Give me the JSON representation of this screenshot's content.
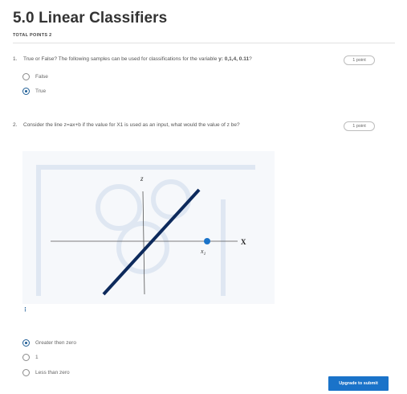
{
  "quiz": {
    "title": "5.0 Linear Classifiers",
    "total_points": "TOTAL POINTS 2"
  },
  "questions": [
    {
      "number": "1.",
      "text_before": "True or False? The following samples can be used for classifications for the variable ",
      "text_bold": "y: 0,1,4,  0.11",
      "text_after": "?",
      "points": "1 point",
      "options": [
        {
          "label": "False",
          "selected": false
        },
        {
          "label": "True",
          "selected": true
        }
      ]
    },
    {
      "number": "2.",
      "text": "Consider the line z=ax+b if the value for X1 is used as an input, what would the value of z be?",
      "points": "1 point",
      "figure": {
        "z_label": "z",
        "x_label": "X",
        "x1_label": "x",
        "x1_sub": "1"
      },
      "hint_icon": "⋮",
      "options": [
        {
          "label": "Greater then zero",
          "selected": true
        },
        {
          "label": "1",
          "selected": false
        },
        {
          "label": "Less than zero",
          "selected": false
        }
      ]
    }
  ],
  "submit_label": "Upgrade to submit",
  "colors": {
    "accent": "#1a73c9",
    "line": "#0d2a5c",
    "point": "#1a73c9"
  }
}
